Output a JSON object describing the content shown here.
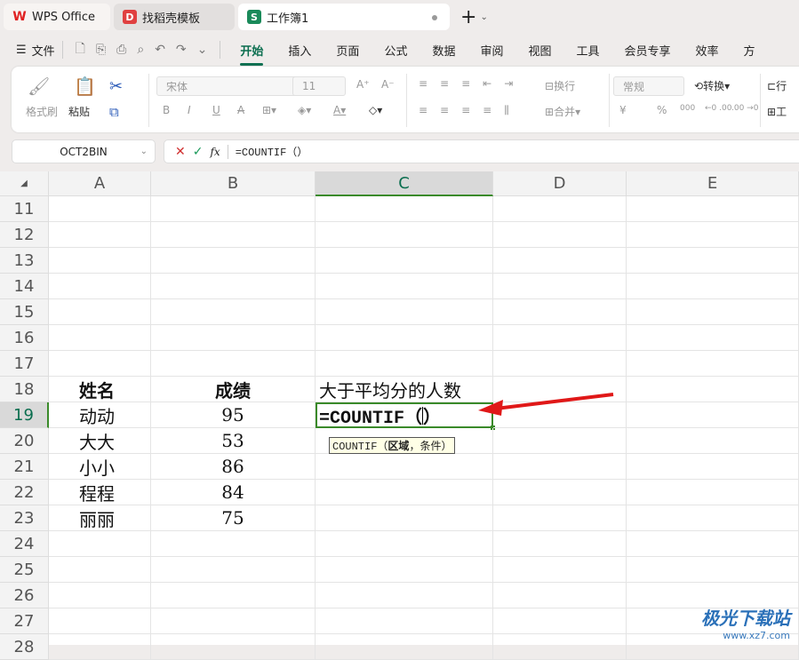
{
  "tabs": [
    {
      "label": "WPS Office",
      "icon": "W"
    },
    {
      "label": "找稻壳模板",
      "icon": "D"
    },
    {
      "label": "工作簿1",
      "icon": "S"
    }
  ],
  "menu": {
    "file": "文件",
    "items": [
      "开始",
      "插入",
      "页面",
      "公式",
      "数据",
      "审阅",
      "视图",
      "工具",
      "会员专享",
      "效率",
      "方"
    ]
  },
  "ribbon": {
    "format_painter": "格式刷",
    "paste": "粘贴",
    "font": "宋体",
    "size": "11",
    "wrap": "换行",
    "merge": "合并",
    "number_format": "常规",
    "convert": "转换",
    "row_col": "行",
    "worksheet": "工",
    "bold": "B",
    "italic": "I",
    "underline": "U",
    "strike": "A",
    "currency": "¥",
    "percent": "%",
    "thousands": "000",
    "inc_dec": "←0 .00",
    "dec_dec": ".00 →0"
  },
  "formula_bar": {
    "name_box": "OCT2BIN",
    "fx": "fx",
    "formula": "=COUNTIF（）"
  },
  "columns": [
    "A",
    "B",
    "C",
    "D",
    "E"
  ],
  "rows": [
    "11",
    "12",
    "13",
    "14",
    "15",
    "16",
    "17",
    "18",
    "19",
    "20",
    "21",
    "22",
    "23",
    "24",
    "25",
    "26",
    "27",
    "28"
  ],
  "cells": {
    "18": [
      "姓名",
      "成绩",
      "大于平均分的人数"
    ],
    "19": [
      "动动",
      "95",
      ""
    ],
    "20": [
      "大大",
      "53",
      ""
    ],
    "21": [
      "小小",
      "86",
      ""
    ],
    "22": [
      "程程",
      "84",
      ""
    ],
    "23": [
      "丽丽",
      "75",
      ""
    ]
  },
  "active_cell": {
    "text_before": "=COUNTIF（",
    "text_after": "）"
  },
  "tooltip": {
    "fn": "COUNTIF（",
    "arg1": "区域",
    "rest": "，条件）"
  },
  "watermark": {
    "name": "极光下载站",
    "url": "www.xz7.com"
  },
  "colors": {
    "accent": "#0b6e4f",
    "selection": "#3a8a2a",
    "arrow": "#e01818"
  }
}
